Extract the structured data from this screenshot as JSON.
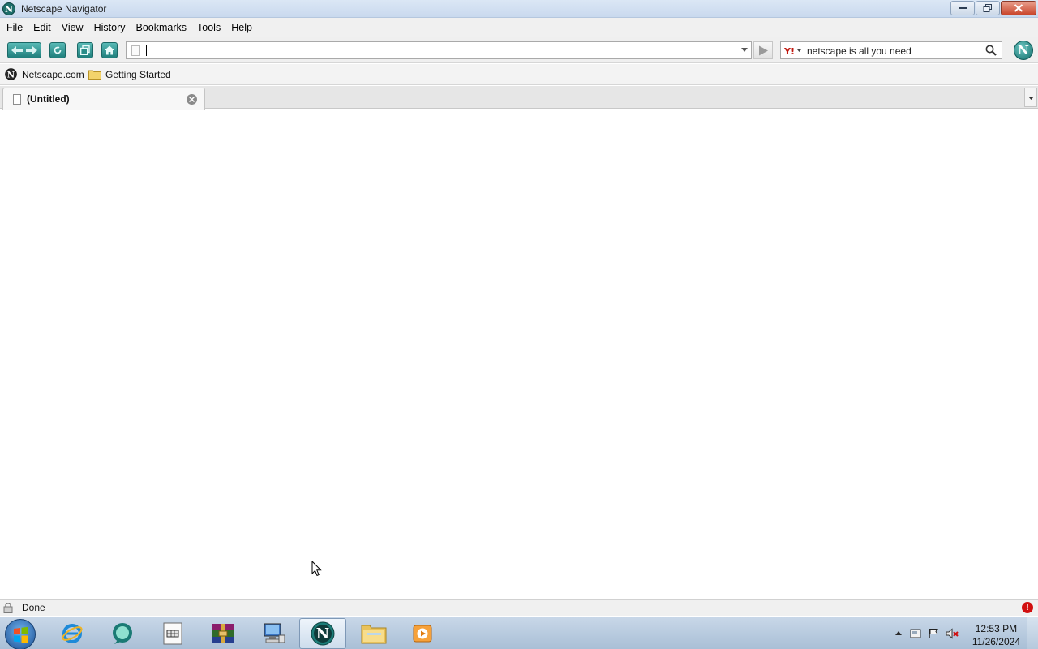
{
  "window": {
    "title": "Netscape Navigator",
    "icon": "netscape-n-icon",
    "controls": [
      "minimize-icon",
      "restore-icon",
      "close-icon"
    ]
  },
  "menu": {
    "items": [
      {
        "label": "File",
        "accel": "F",
        "rest": "ile"
      },
      {
        "label": "Edit",
        "accel": "E",
        "rest": "dit"
      },
      {
        "label": "View",
        "accel": "V",
        "rest": "iew"
      },
      {
        "label": "History",
        "accel": "H",
        "rest": "istory"
      },
      {
        "label": "Bookmarks",
        "accel": "B",
        "rest": "ookmarks"
      },
      {
        "label": "Tools",
        "accel": "T",
        "rest": "ools"
      },
      {
        "label": "Help",
        "accel": "H",
        "rest": "elp"
      }
    ]
  },
  "toolbar": {
    "buttons": [
      "back-icon",
      "forward-icon",
      "reload-icon",
      "new-tab-icon",
      "home-icon"
    ],
    "url_value": "",
    "url_placeholder": "",
    "go_icon": "go-arrow-icon",
    "search": {
      "engine_icon": "yahoo-icon",
      "text": "netscape is all you need",
      "icon": "search-icon"
    },
    "brand_button": "N"
  },
  "bookmarks": {
    "items": [
      {
        "label": "Netscape.com",
        "icon": "netscape-n-icon"
      },
      {
        "label": "Getting Started",
        "icon": "folder-icon"
      }
    ]
  },
  "tabs": {
    "items": [
      {
        "label": "(Untitled)",
        "active": true
      }
    ]
  },
  "status": {
    "text": "Done",
    "alert": "!"
  },
  "taskbar": {
    "items": [
      "start-orb-icon",
      "internet-explorer-icon",
      "chat-app-icon",
      "spreadsheet-icon",
      "winrar-icon",
      "network-computer-icon",
      "netscape-icon",
      "file-explorer-icon",
      "media-player-icon"
    ],
    "active_item": "netscape-icon",
    "clock": {
      "time": "12:53 PM",
      "date": "11/26/2024"
    }
  },
  "colors": {
    "teal_button": "#1f7f7c",
    "title_bar": "#c9d9ee",
    "close_red": "#c9462c",
    "taskbar": "#a9bfd6"
  }
}
